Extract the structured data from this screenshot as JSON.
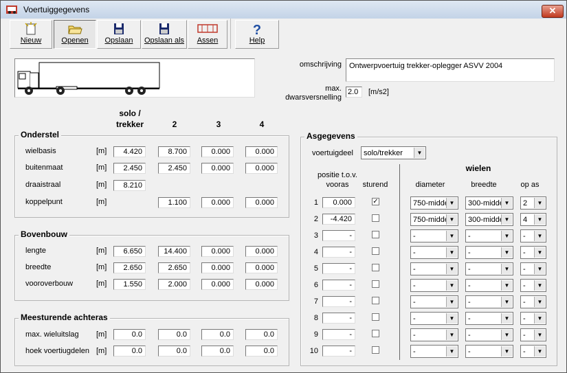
{
  "window": {
    "title": "Voertuiggegevens",
    "close_glyph": "✕"
  },
  "toolbar": [
    {
      "label": "Nieuw",
      "icon": "new-file-icon"
    },
    {
      "label": "Openen",
      "icon": "open-folder-icon"
    },
    {
      "label": "Opslaan",
      "icon": "floppy-disk-icon"
    },
    {
      "label": "Opslaan als",
      "icon": "floppy-disk-save-as-icon"
    },
    {
      "label": "Assen",
      "icon": "axle-layout-icon"
    },
    {
      "label": "Help",
      "icon": "question-mark-icon"
    }
  ],
  "description": {
    "omschrijving_label": "omschrijving",
    "omschrijving_value": "Ontwerpvoertuig trekker-oplegger ASVV 2004",
    "accel_label_1": "max.",
    "accel_label_2": "dwarsversnelling",
    "accel_value": "2.0",
    "accel_unit": "[m/s2]"
  },
  "columns": {
    "c1a": "solo /",
    "c1b": "trekker",
    "c2": "2",
    "c3": "3",
    "c4": "4"
  },
  "onderstel": {
    "title": "Onderstel",
    "rows": [
      {
        "label": "wielbasis",
        "unit": "[m]",
        "values": [
          "4.420",
          "8.700",
          "0.000",
          "0.000"
        ]
      },
      {
        "label": "buitenmaat",
        "unit": "[m]",
        "values": [
          "2.450",
          "2.450",
          "0.000",
          "0.000"
        ]
      },
      {
        "label": "draaistraal",
        "unit": "[m]",
        "values": [
          "8.210"
        ]
      },
      {
        "label": "koppelpunt",
        "unit": "[m]",
        "values": [
          "",
          "1.100",
          "0.000",
          "0.000"
        ]
      }
    ]
  },
  "bovenbouw": {
    "title": "Bovenbouw",
    "rows": [
      {
        "label": "lengte",
        "unit": "[m]",
        "values": [
          "6.650",
          "14.400",
          "0.000",
          "0.000"
        ]
      },
      {
        "label": "breedte",
        "unit": "[m]",
        "values": [
          "2.650",
          "2.650",
          "0.000",
          "0.000"
        ]
      },
      {
        "label": "vooroverbouw",
        "unit": "[m]",
        "values": [
          "1.550",
          "2.000",
          "0.000",
          "0.000"
        ]
      }
    ]
  },
  "meesturend": {
    "title": "Meesturende achteras",
    "rows": [
      {
        "label": "max. wieluitslag",
        "unit": "[m]",
        "values": [
          "0.0",
          "0.0",
          "0.0",
          "0.0"
        ]
      },
      {
        "label": "hoek voertiugdelen",
        "unit": "[m]",
        "values": [
          "0.0",
          "0.0",
          "0.0",
          "0.0"
        ]
      }
    ]
  },
  "asgegevens": {
    "title": "Asgegevens",
    "voertuigdeel_label": "voertuigdeel",
    "voertuigdeel_value": "solo/trekker",
    "wielen_label": "wielen",
    "pos_header_1": "positie t.o.v.",
    "pos_header_2": "vooras",
    "sturend_header": "sturend",
    "diameter_header": "diameter",
    "breedte_header": "breedte",
    "opas_header": "op as",
    "rows": [
      {
        "n": "1",
        "pos": "0.000",
        "sturend": true,
        "diameter": "750-midde",
        "breedte": "300-midde",
        "opas": "2"
      },
      {
        "n": "2",
        "pos": "-4.420",
        "sturend": false,
        "diameter": "750-midde",
        "breedte": "300-midde",
        "opas": "4"
      },
      {
        "n": "3",
        "pos": "-",
        "sturend": false,
        "diameter": "-",
        "breedte": "-",
        "opas": "-"
      },
      {
        "n": "4",
        "pos": "-",
        "sturend": false,
        "diameter": "-",
        "breedte": "-",
        "opas": "-"
      },
      {
        "n": "5",
        "pos": "-",
        "sturend": false,
        "diameter": "-",
        "breedte": "-",
        "opas": "-"
      },
      {
        "n": "6",
        "pos": "-",
        "sturend": false,
        "diameter": "-",
        "breedte": "-",
        "opas": "-"
      },
      {
        "n": "7",
        "pos": "-",
        "sturend": false,
        "diameter": "-",
        "breedte": "-",
        "opas": "-"
      },
      {
        "n": "8",
        "pos": "-",
        "sturend": false,
        "diameter": "-",
        "breedte": "-",
        "opas": "-"
      },
      {
        "n": "9",
        "pos": "-",
        "sturend": false,
        "diameter": "-",
        "breedte": "-",
        "opas": "-"
      },
      {
        "n": "10",
        "pos": "-",
        "sturend": false,
        "diameter": "-",
        "breedte": "-",
        "opas": "-"
      }
    ]
  }
}
